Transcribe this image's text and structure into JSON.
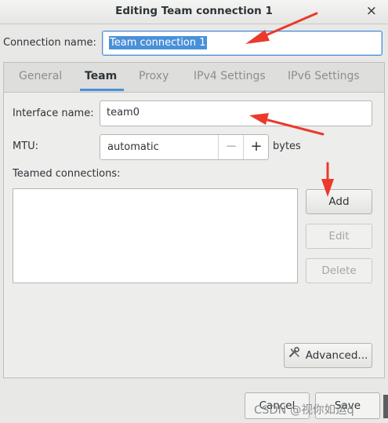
{
  "window": {
    "title": "Editing Team connection 1",
    "close_glyph": "×"
  },
  "connection": {
    "label": "Connection name:",
    "value": "Team connection 1"
  },
  "tabs": [
    {
      "label": "General",
      "active": false
    },
    {
      "label": "Team",
      "active": true
    },
    {
      "label": "Proxy",
      "active": false
    },
    {
      "label": "IPv4 Settings",
      "active": false
    },
    {
      "label": "IPv6 Settings",
      "active": false
    }
  ],
  "team": {
    "interface_label": "Interface name:",
    "interface_value": "team0",
    "mtu_label": "MTU:",
    "mtu_value": "automatic",
    "mtu_minus": "−",
    "mtu_plus": "+",
    "mtu_unit": "bytes",
    "teamed_label": "Teamed connections:",
    "add_label": "Add",
    "edit_label": "Edit",
    "delete_label": "Delete",
    "advanced_label": "Advanced..."
  },
  "footer": {
    "cancel_label": "Cancel",
    "save_label": "Save"
  },
  "watermark": "CSDN @视你如运q",
  "colors": {
    "accent": "#4a90d9",
    "annotation_arrow": "#ea3a2b"
  },
  "icons": {
    "advanced": "wrench-screwdriver-icon"
  }
}
